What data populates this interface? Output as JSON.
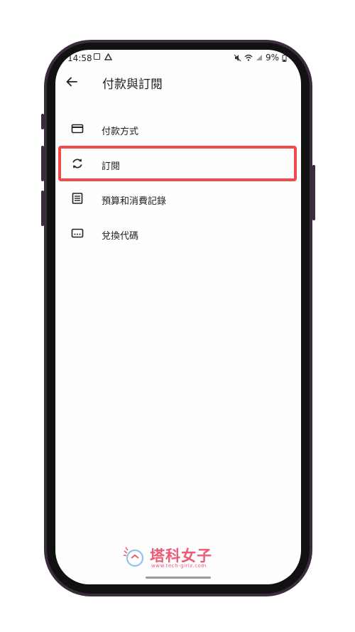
{
  "status_bar": {
    "time": "14:58",
    "battery": "9%"
  },
  "app_bar": {
    "title": "付款與訂閱"
  },
  "menu": {
    "items": [
      {
        "label": "付款方式",
        "icon": "credit-card-icon"
      },
      {
        "label": "訂閱",
        "icon": "sync-icon"
      },
      {
        "label": "預算和消費記錄",
        "icon": "receipt-list-icon"
      },
      {
        "label": "兌換代碼",
        "icon": "redeem-code-icon"
      }
    ]
  },
  "watermark": {
    "title": "塔科女子",
    "url": "www.tech-girlz.com"
  },
  "colors": {
    "highlight": "#f04a4a",
    "watermark": "#ec5a75",
    "frame": "#3a2b3d"
  }
}
